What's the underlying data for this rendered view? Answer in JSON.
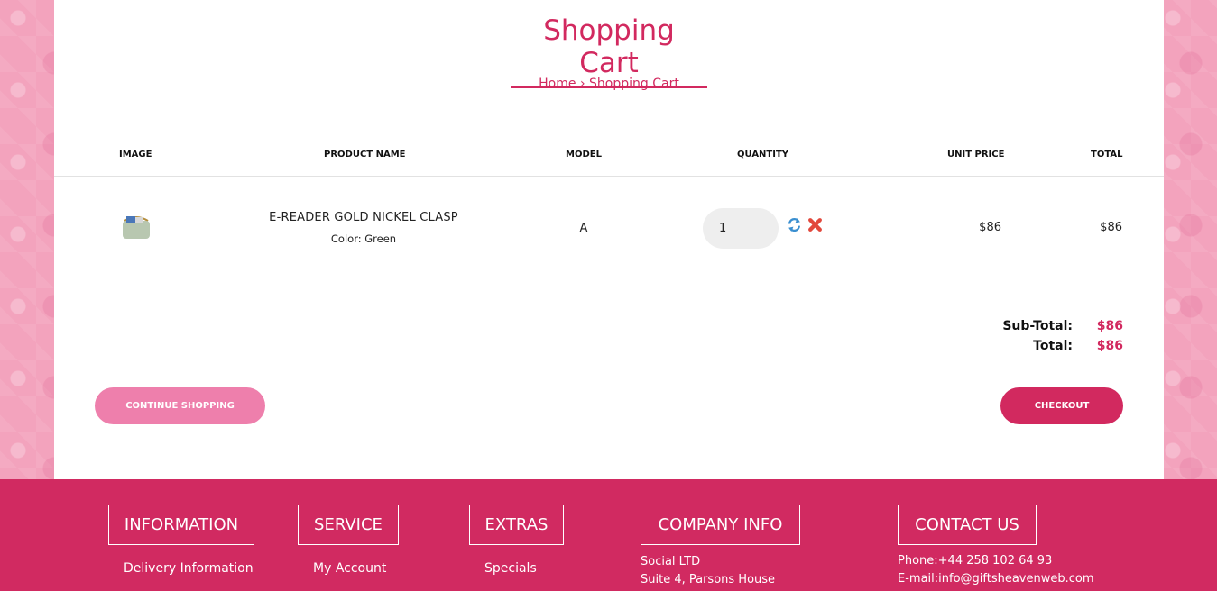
{
  "page": {
    "title": "Shopping Cart",
    "breadcrumb": {
      "home": "Home",
      "separator": "›",
      "current": "Shopping Cart"
    }
  },
  "cart": {
    "columns": [
      "IMAGE",
      "PRODUCT NAME",
      "MODEL",
      "QUANTITY",
      "UNIT PRICE",
      "TOTAL"
    ],
    "items": [
      {
        "name": "E-READER GOLD NICKEL CLASP",
        "option": "Color: Green",
        "model": "A",
        "quantity": "1",
        "unit_price": "$86",
        "total": "$86",
        "image_icon": "handbag-image"
      }
    ],
    "totals": {
      "subtotal_label": "Sub-Total:",
      "subtotal_value": "$86",
      "total_label": "Total:",
      "total_value": "$86"
    },
    "actions": {
      "continue_label": "CONTINUE SHOPPING",
      "checkout_label": "CHECKOUT",
      "update_icon": "refresh-icon",
      "remove_icon": "remove-icon"
    }
  },
  "footer": {
    "sections": [
      {
        "title": "INFORMATION",
        "link": "Delivery Information"
      },
      {
        "title": "SERVICE",
        "link": "My Account"
      },
      {
        "title": "EXTRAS",
        "link": "Specials"
      },
      {
        "title": "COMPANY INFO",
        "lines": [
          "Social LTD",
          "Suite 4, Parsons House"
        ]
      },
      {
        "title": "CONTACT US",
        "lines": [
          "Phone:+44 258 102 64 93",
          "E-mail:info@giftsheavenweb.com"
        ]
      }
    ]
  },
  "colors": {
    "accent": "#d2295f",
    "accent_light": "#ee7fac",
    "footer_bg": "#d12a61",
    "page_bg": "#f3a3bd"
  }
}
